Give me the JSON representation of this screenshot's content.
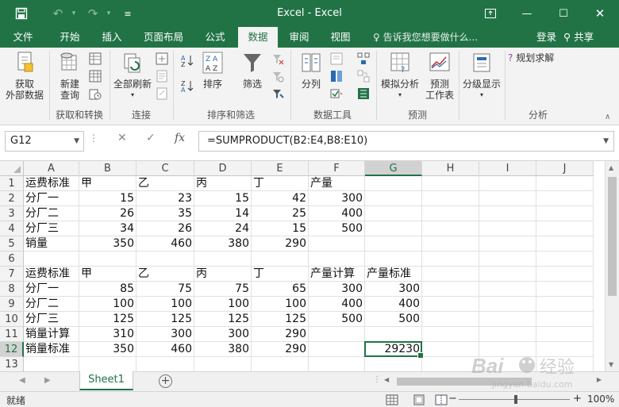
{
  "window": {
    "title": "Excel - Excel",
    "accent_color": "#217346",
    "buttons": [
      "ribbon-display-options",
      "minimize",
      "maximize",
      "close"
    ]
  },
  "ribbon_tabs": [
    {
      "label": "文件"
    },
    {
      "label": "开始"
    },
    {
      "label": "插入"
    },
    {
      "label": "页面布局"
    },
    {
      "label": "公式"
    },
    {
      "label": "数据",
      "active": true
    },
    {
      "label": "审阅"
    },
    {
      "label": "视图"
    }
  ],
  "tell_me": "告诉我您想要做什么...",
  "login": "登录",
  "share": "共享",
  "ribbon": {
    "get_external_line1": "获取",
    "get_external_line2": "外部数据",
    "new_query_line1": "新建",
    "new_query_line2": "查询",
    "refresh_all": "全部刷新",
    "sort": "排序",
    "filter": "筛选",
    "text_to_columns": "分列",
    "what_if": "模拟分析",
    "forecast_line1": "预测",
    "forecast_line2": "工作表",
    "outline": "分级显示",
    "solver": "规划求解",
    "groups": {
      "get_transform": "获取和转换",
      "connections": "连接",
      "sort_filter": "排序和筛选",
      "data_tools": "数据工具",
      "forecast": "预测",
      "analysis": "分析"
    }
  },
  "formula_bar": {
    "name_box": "G12",
    "fx": "fx",
    "formula": "=SUMPRODUCT(B2:E4,B8:E10)"
  },
  "columns": [
    "A",
    "B",
    "C",
    "D",
    "E",
    "F",
    "G",
    "H",
    "I",
    "J"
  ],
  "rows": [
    "1",
    "2",
    "3",
    "4",
    "5",
    "6",
    "7",
    "8",
    "9",
    "10",
    "11",
    "12",
    "13"
  ],
  "selected_cell": "G12",
  "cells": [
    [
      "运费标准",
      "甲",
      "乙",
      "丙",
      "丁",
      "产量",
      "",
      "",
      "",
      ""
    ],
    [
      "分厂一",
      "15",
      "23",
      "15",
      "42",
      "300",
      "",
      "",
      "",
      ""
    ],
    [
      "分厂二",
      "26",
      "35",
      "14",
      "25",
      "400",
      "",
      "",
      "",
      ""
    ],
    [
      "分厂三",
      "34",
      "26",
      "24",
      "15",
      "500",
      "",
      "",
      "",
      ""
    ],
    [
      "销量",
      "350",
      "460",
      "380",
      "290",
      "",
      "",
      "",
      "",
      ""
    ],
    [
      "",
      "",
      "",
      "",
      "",
      "",
      "",
      "",
      "",
      ""
    ],
    [
      "运费标准",
      "甲",
      "乙",
      "丙",
      "丁",
      "产量计算",
      "产量标准",
      "",
      "",
      ""
    ],
    [
      "分厂一",
      "85",
      "75",
      "75",
      "65",
      "300",
      "300",
      "",
      "",
      ""
    ],
    [
      "分厂二",
      "100",
      "100",
      "100",
      "100",
      "400",
      "400",
      "",
      "",
      ""
    ],
    [
      "分厂三",
      "125",
      "125",
      "125",
      "125",
      "500",
      "500",
      "",
      "",
      ""
    ],
    [
      "销量计算",
      "310",
      "300",
      "300",
      "290",
      "",
      "",
      "",
      "",
      ""
    ],
    [
      "销量标准",
      "350",
      "460",
      "380",
      "290",
      "",
      "29230",
      "",
      "",
      ""
    ],
    [
      "",
      "",
      "",
      "",
      "",
      "",
      "",
      "",
      "",
      ""
    ]
  ],
  "sheet_tab": "Sheet1",
  "status": {
    "ready": "就绪",
    "zoom": "100%"
  },
  "watermark": {
    "brand": "Bai",
    "brand2": "经验",
    "url": "jingyan.baidu.com"
  }
}
